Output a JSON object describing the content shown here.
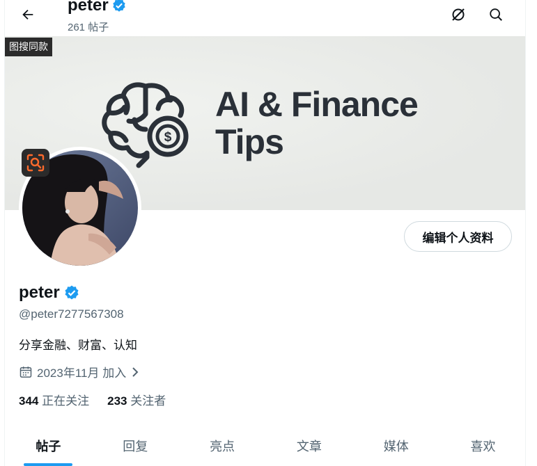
{
  "header": {
    "name": "peter",
    "post_count": "261 帖子"
  },
  "banner": {
    "badge_label": "图搜同款",
    "title_line1": "AI & Finance",
    "title_line2": "Tips"
  },
  "profile": {
    "name": "peter",
    "handle": "@peter7277567308",
    "bio": "分享金融、财富、认知",
    "joined": "2023年11月 加入",
    "following_count": "344",
    "following_label": "正在关注",
    "followers_count": "233",
    "followers_label": "关注者",
    "edit_label": "编辑个人资料"
  },
  "tabs": [
    {
      "label": "帖子"
    },
    {
      "label": "回复"
    },
    {
      "label": "亮点"
    },
    {
      "label": "文章"
    },
    {
      "label": "媒体"
    },
    {
      "label": "喜欢"
    }
  ],
  "colors": {
    "accent": "#1d9bf0",
    "verified": "#1d9bf0",
    "text_primary": "#0f1419",
    "text_secondary": "#536471",
    "banner_text": "#2a3038"
  }
}
